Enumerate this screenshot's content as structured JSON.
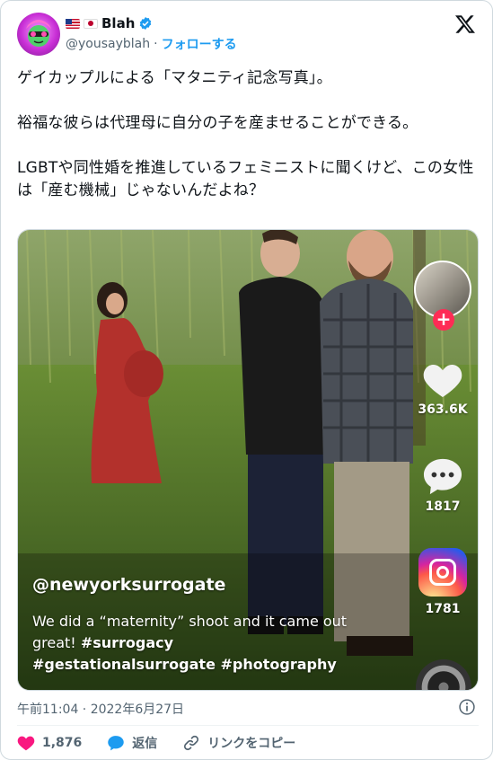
{
  "header": {
    "display_name": "Blah",
    "handle": "@yousayblah",
    "separator": "·",
    "follow_label": "フォローする"
  },
  "tweet": {
    "text": "ゲイカップルによる「マタニティ記念写真」。\n\n裕福な彼らは代理母に自分の子を産ませることができる。\n\nLGBTや同性婚を推進しているフェミニストに聞くけど、この女性は「産む機械」じゃないんだよね？"
  },
  "media": {
    "handle": "@newyorksurrogate",
    "caption_plain": "We did a “maternity” shoot and it came out great! ",
    "caption_tags_1": "#surrogacy",
    "caption_tags_2": "#gestationalsurrogate #photography",
    "likes": "363.6K",
    "comments": "1817",
    "shares": "1781",
    "plus_label": "+"
  },
  "footer": {
    "timestamp": "午前11:04 · 2022年6月27日",
    "like_count": "1,876",
    "reply_label": "返信",
    "copy_link_label": "リンクをコピー"
  },
  "colors": {
    "like": "#f91880",
    "reply": "#1d9bf0",
    "follow": "#1d9bf0",
    "tiktok_plus": "#fe2c55"
  },
  "icons": [
    "verified-icon",
    "x-logo-icon",
    "heart-icon",
    "comment-icon",
    "instagram-icon",
    "info-icon",
    "reply-icon",
    "link-icon"
  ]
}
